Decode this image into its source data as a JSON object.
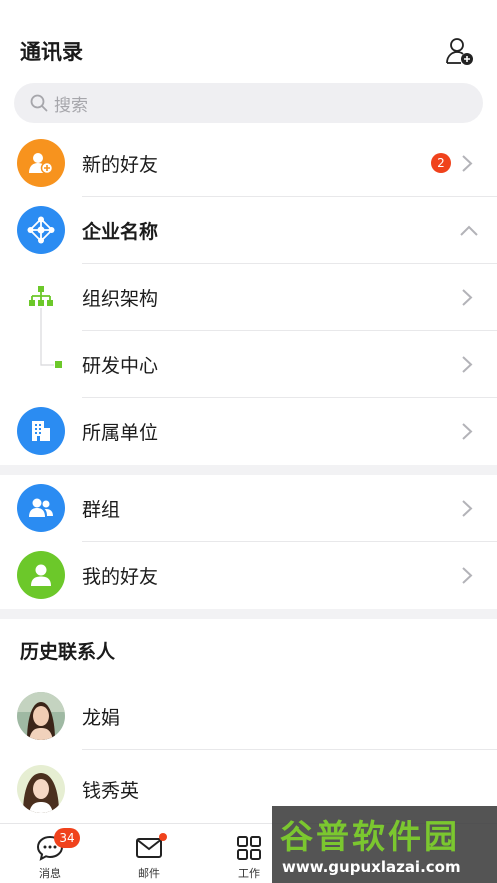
{
  "header": {
    "title": "通讯录"
  },
  "search": {
    "placeholder": "搜索"
  },
  "rows": {
    "new_friends": {
      "label": "新的好友",
      "badge": "2"
    },
    "company": {
      "label": "企业名称"
    },
    "org": {
      "label": "组织架构"
    },
    "rd": {
      "label": "研发中心"
    },
    "unit": {
      "label": "所属单位"
    },
    "groups": {
      "label": "群组"
    },
    "my_friends": {
      "label": "我的好友"
    }
  },
  "history": {
    "title": "历史联系人",
    "contacts": [
      {
        "name": "龙娟"
      },
      {
        "name": "钱秀英"
      }
    ]
  },
  "tabbar": {
    "tabs": [
      {
        "label": "消息",
        "badge": "34"
      },
      {
        "label": "邮件"
      },
      {
        "label": "工作"
      }
    ]
  },
  "watermark": {
    "title": "谷普软件园",
    "url": "www.gupuxlazai.com"
  },
  "colors": {
    "orange": "#f7931e",
    "blue": "#2b8cf2",
    "green": "#6cc82a",
    "badge": "#f0421c"
  },
  "icons": [
    "add-contact-icon",
    "search-icon",
    "new-friend-icon",
    "network-icon",
    "org-tree-icon",
    "building-icon",
    "group-icon",
    "person-icon",
    "chevron-right-icon",
    "chevron-up-icon",
    "message-icon",
    "mail-icon",
    "grid-icon"
  ]
}
